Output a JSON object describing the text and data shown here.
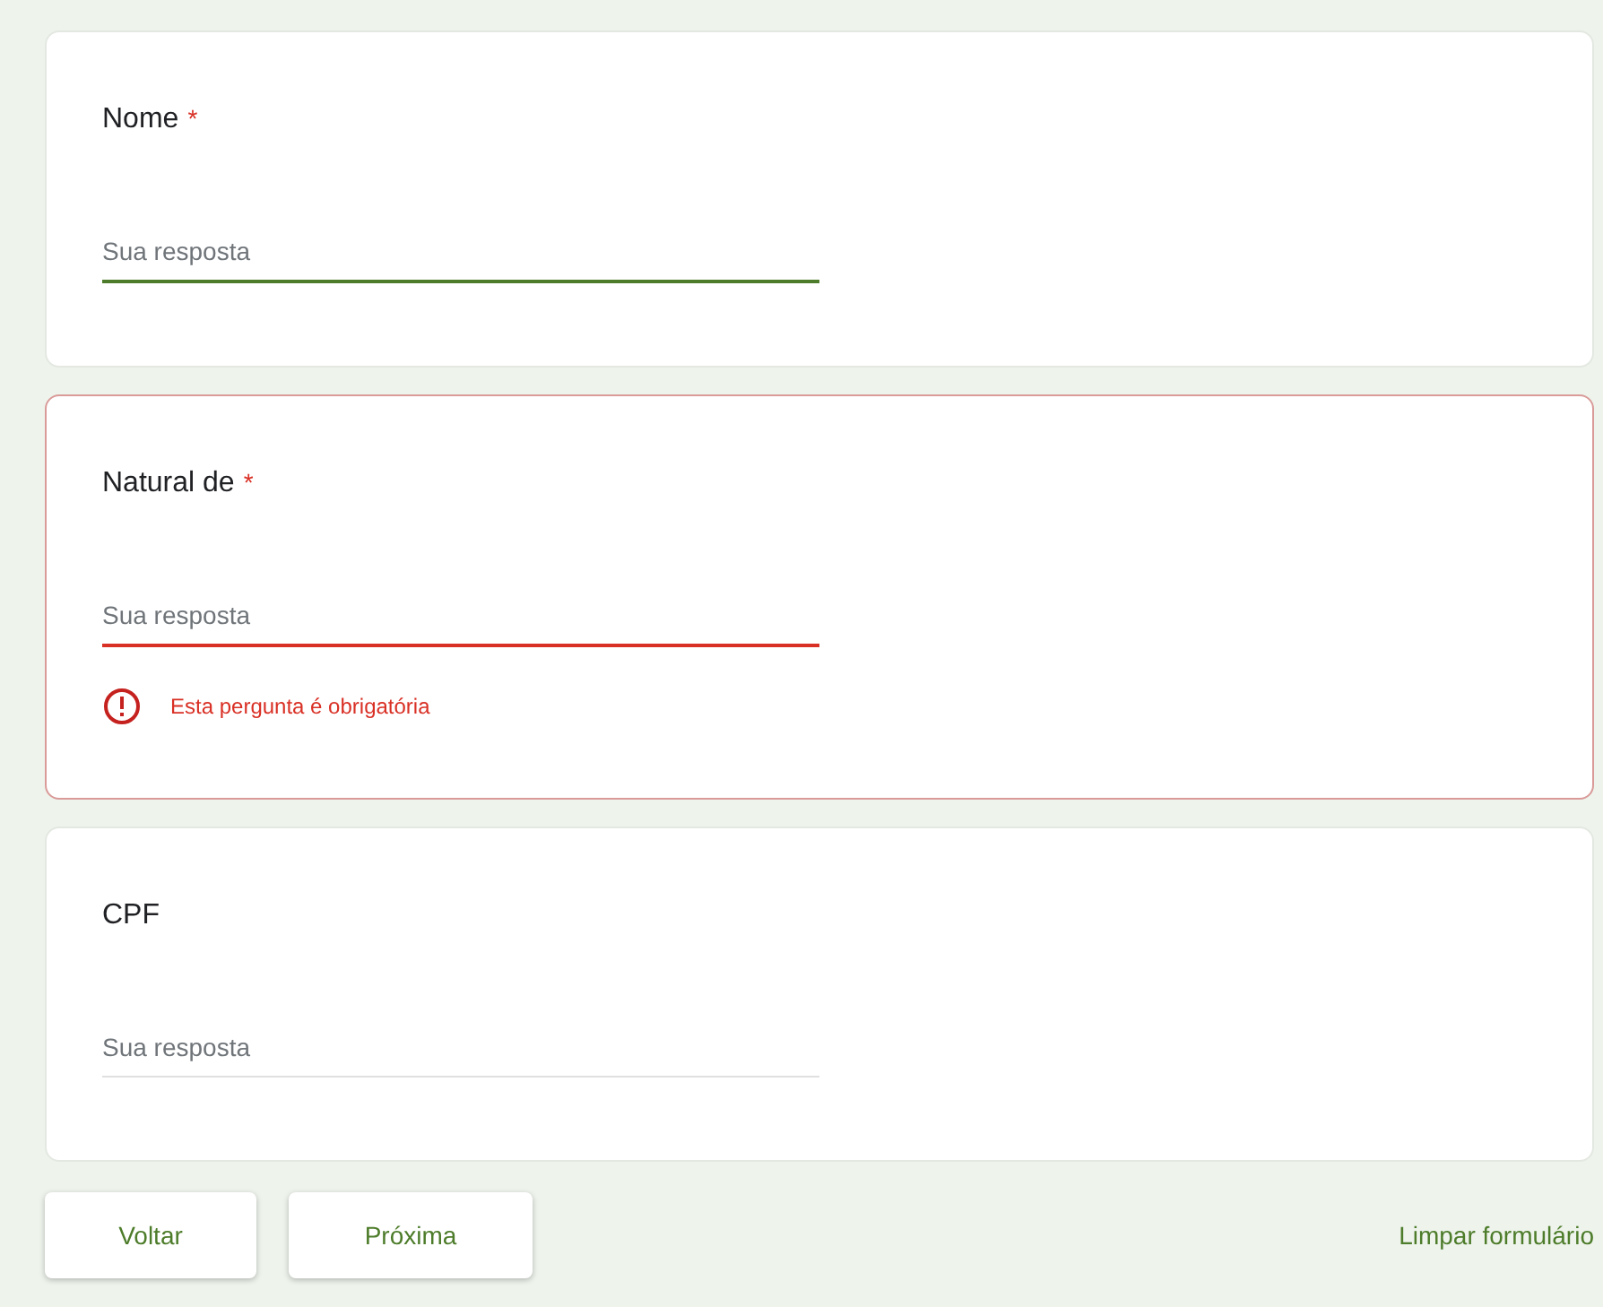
{
  "questions": [
    {
      "label": "Nome",
      "required_mark": "*",
      "placeholder": "Sua resposta",
      "focused": true,
      "error": false
    },
    {
      "label": "Natural de",
      "required_mark": "*",
      "placeholder": "Sua resposta",
      "focused": false,
      "error": true,
      "error_message": "Esta pergunta é obrigatória"
    },
    {
      "label": "CPF",
      "placeholder": "Sua resposta",
      "focused": false,
      "error": false
    }
  ],
  "buttons": [
    "Voltar",
    "Próxima"
  ],
  "clear_link": "Limpar formulário"
}
